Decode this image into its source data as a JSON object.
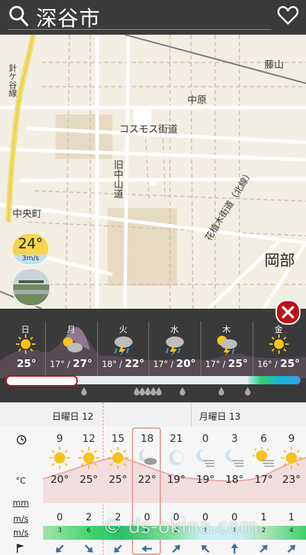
{
  "header": {
    "title": "深谷市"
  },
  "map": {
    "labels": {
      "fujiyama": "藤山",
      "nakahara": "中原",
      "cosmos": "コスモス街道",
      "nakayama": "旧中山道",
      "chuocho": "中央町",
      "kaido": "花植木街道（北線）",
      "okabe": "岡部",
      "harigaya": "針ケ谷線"
    },
    "current_temp": "24°",
    "current_wind": "3m/s"
  },
  "days": [
    {
      "name": "日",
      "low": "",
      "high": "25°",
      "icon": "sun-icon"
    },
    {
      "name": "月",
      "low": "17°",
      "high": "27°",
      "icon": "partly-cloudy-icon"
    },
    {
      "name": "火",
      "low": "18°",
      "high": "22°",
      "icon": "storm-icon"
    },
    {
      "name": "水",
      "low": "17°",
      "high": "20°",
      "icon": "storm-icon"
    },
    {
      "name": "木",
      "low": "17°",
      "high": "25°",
      "icon": "sun-storm-icon"
    },
    {
      "name": "金",
      "low": "16°",
      "high": "25°",
      "icon": "sun-icon"
    }
  ],
  "table": {
    "date1": "日曜日 12",
    "date2": "月曜日 13",
    "row_labels": {
      "temp": "°C",
      "precip": "mm",
      "wind": "m/s",
      "gust": "m/s"
    },
    "hours": [
      "9",
      "12",
      "15",
      "18",
      "21",
      "0",
      "3",
      "6",
      "9"
    ],
    "temps": [
      "20°",
      "25°",
      "25°",
      "22°",
      "19°",
      "19°",
      "18°",
      "17°",
      "23°"
    ],
    "icons": [
      "sun-icon",
      "sun-icon",
      "sun-icon",
      "moon-cloud-icon",
      "moon-icon",
      "moon-haze-icon",
      "moon-haze-icon",
      "sun-haze-icon",
      "sun-icon"
    ],
    "winds": [
      "0",
      "2",
      "2",
      "0",
      "0",
      "0",
      "0",
      "1",
      "1"
    ],
    "gusts": [
      "3",
      "6",
      "7",
      "6",
      "2",
      "1",
      "1",
      "2",
      "4"
    ]
  },
  "watermark": "ds-okina.com",
  "colors": {
    "accent": "#b8141b",
    "sun": "#f7c21b",
    "panel": "#3a3a3a"
  }
}
